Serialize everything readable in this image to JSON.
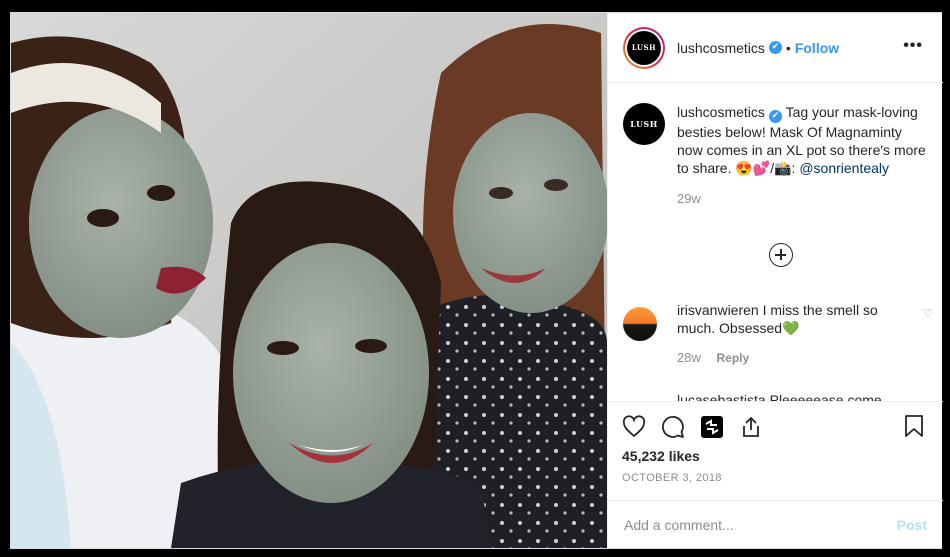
{
  "post": {
    "username": "lushcosmetics",
    "verified_glyph": "✔",
    "separator": "•",
    "follow_label": "Follow",
    "more_glyph": "•••",
    "avatar_text": "LUSH",
    "photo_description_icon": "photo-three-women-clay-masks"
  },
  "caption": {
    "username": "lushcosmetics",
    "text": "Tag your mask-loving besties below! Mask Of Magnaminty now comes in an XL pot so there's more to share. 😍💕/📸: ",
    "mention": "@sonrientealy",
    "time": "29w"
  },
  "comments": [
    {
      "username": "irisvanwieren",
      "text": "I miss the smell so much. Obsessed💚",
      "time": "28w",
      "reply_label": "Reply",
      "like_icon": "heart-outline-icon"
    },
    {
      "username": "lucasebastista",
      "text": "Pleeeeease come",
      "time": "",
      "reply_label": ""
    }
  ],
  "actions": {
    "icons": [
      "heart-outline-icon",
      "comment-icon",
      "share-reel-icon",
      "share-upload-icon",
      "bookmark-icon"
    ],
    "likes": "45,232 likes",
    "date": "OCTOBER 3, 2018"
  },
  "composer": {
    "placeholder": "Add a comment...",
    "post_label": "Post"
  },
  "colors": {
    "accent": "#3897f0",
    "muted": "#8e8e8e",
    "text": "#262626",
    "post_disabled": "#b2dffc"
  }
}
